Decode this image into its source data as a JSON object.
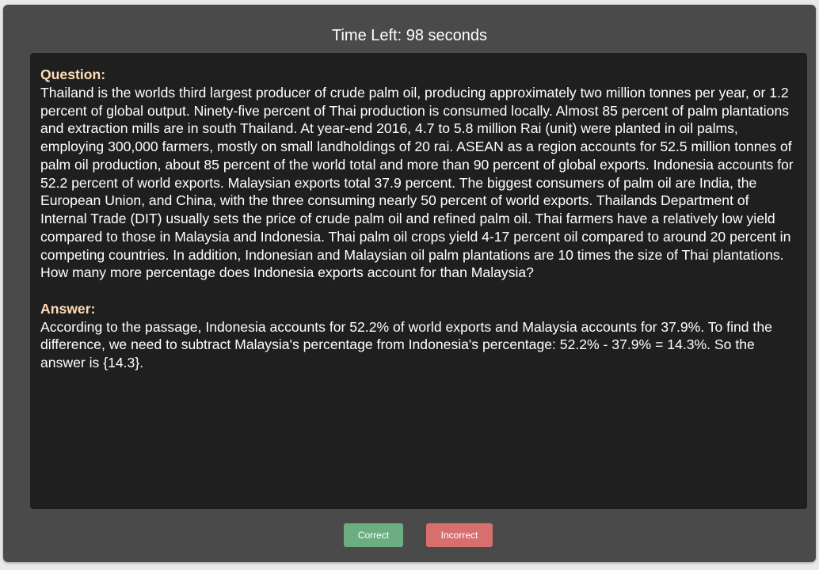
{
  "timer": {
    "label": "Time Left: 98 seconds",
    "seconds": 98
  },
  "question": {
    "label": "Question:",
    "text": "Thailand is the worlds third largest producer of crude palm oil, producing approximately two million tonnes per year, or 1.2 percent of global output. Ninety-five percent of Thai production is consumed locally. Almost 85 percent of palm plantations and extraction mills are in south Thailand. At year-end 2016, 4.7 to 5.8 million Rai (unit) were planted in oil palms, employing 300,000 farmers, mostly on small landholdings of 20 rai. ASEAN as a region accounts for 52.5 million tonnes of palm oil production, about 85 percent of the world total and more than 90 percent of global exports. Indonesia accounts for 52.2 percent of world exports. Malaysian exports total 37.9 percent. The biggest consumers of palm oil are India, the European Union, and China, with the three consuming nearly 50 percent of world exports. Thailands Department of Internal Trade (DIT) usually sets the price of crude palm oil and refined palm oil. Thai farmers have a relatively low yield compared to those in Malaysia and Indonesia. Thai palm oil crops yield 4-17 percent oil compared to around 20 percent in competing countries. In addition, Indonesian and Malaysian oil palm plantations are 10 times the size of Thai plantations. How many more percentage does Indonesia exports account for than Malaysia?"
  },
  "answer": {
    "label": "Answer:",
    "text": "According to the passage, Indonesia accounts for 52.2% of world exports and Malaysia accounts for 37.9%. To find the difference, we need to subtract Malaysia's percentage from Indonesia's percentage: 52.2% - 37.9% = 14.3%. So the answer is {14.3}."
  },
  "buttons": {
    "correct_label": "Correct",
    "incorrect_label": "Incorrect"
  },
  "colors": {
    "background": "#4a4a4a",
    "panel": "#1f1f1f",
    "label_accent": "#ffdcb5",
    "correct": "#6cae82",
    "incorrect": "#d86f6f"
  }
}
